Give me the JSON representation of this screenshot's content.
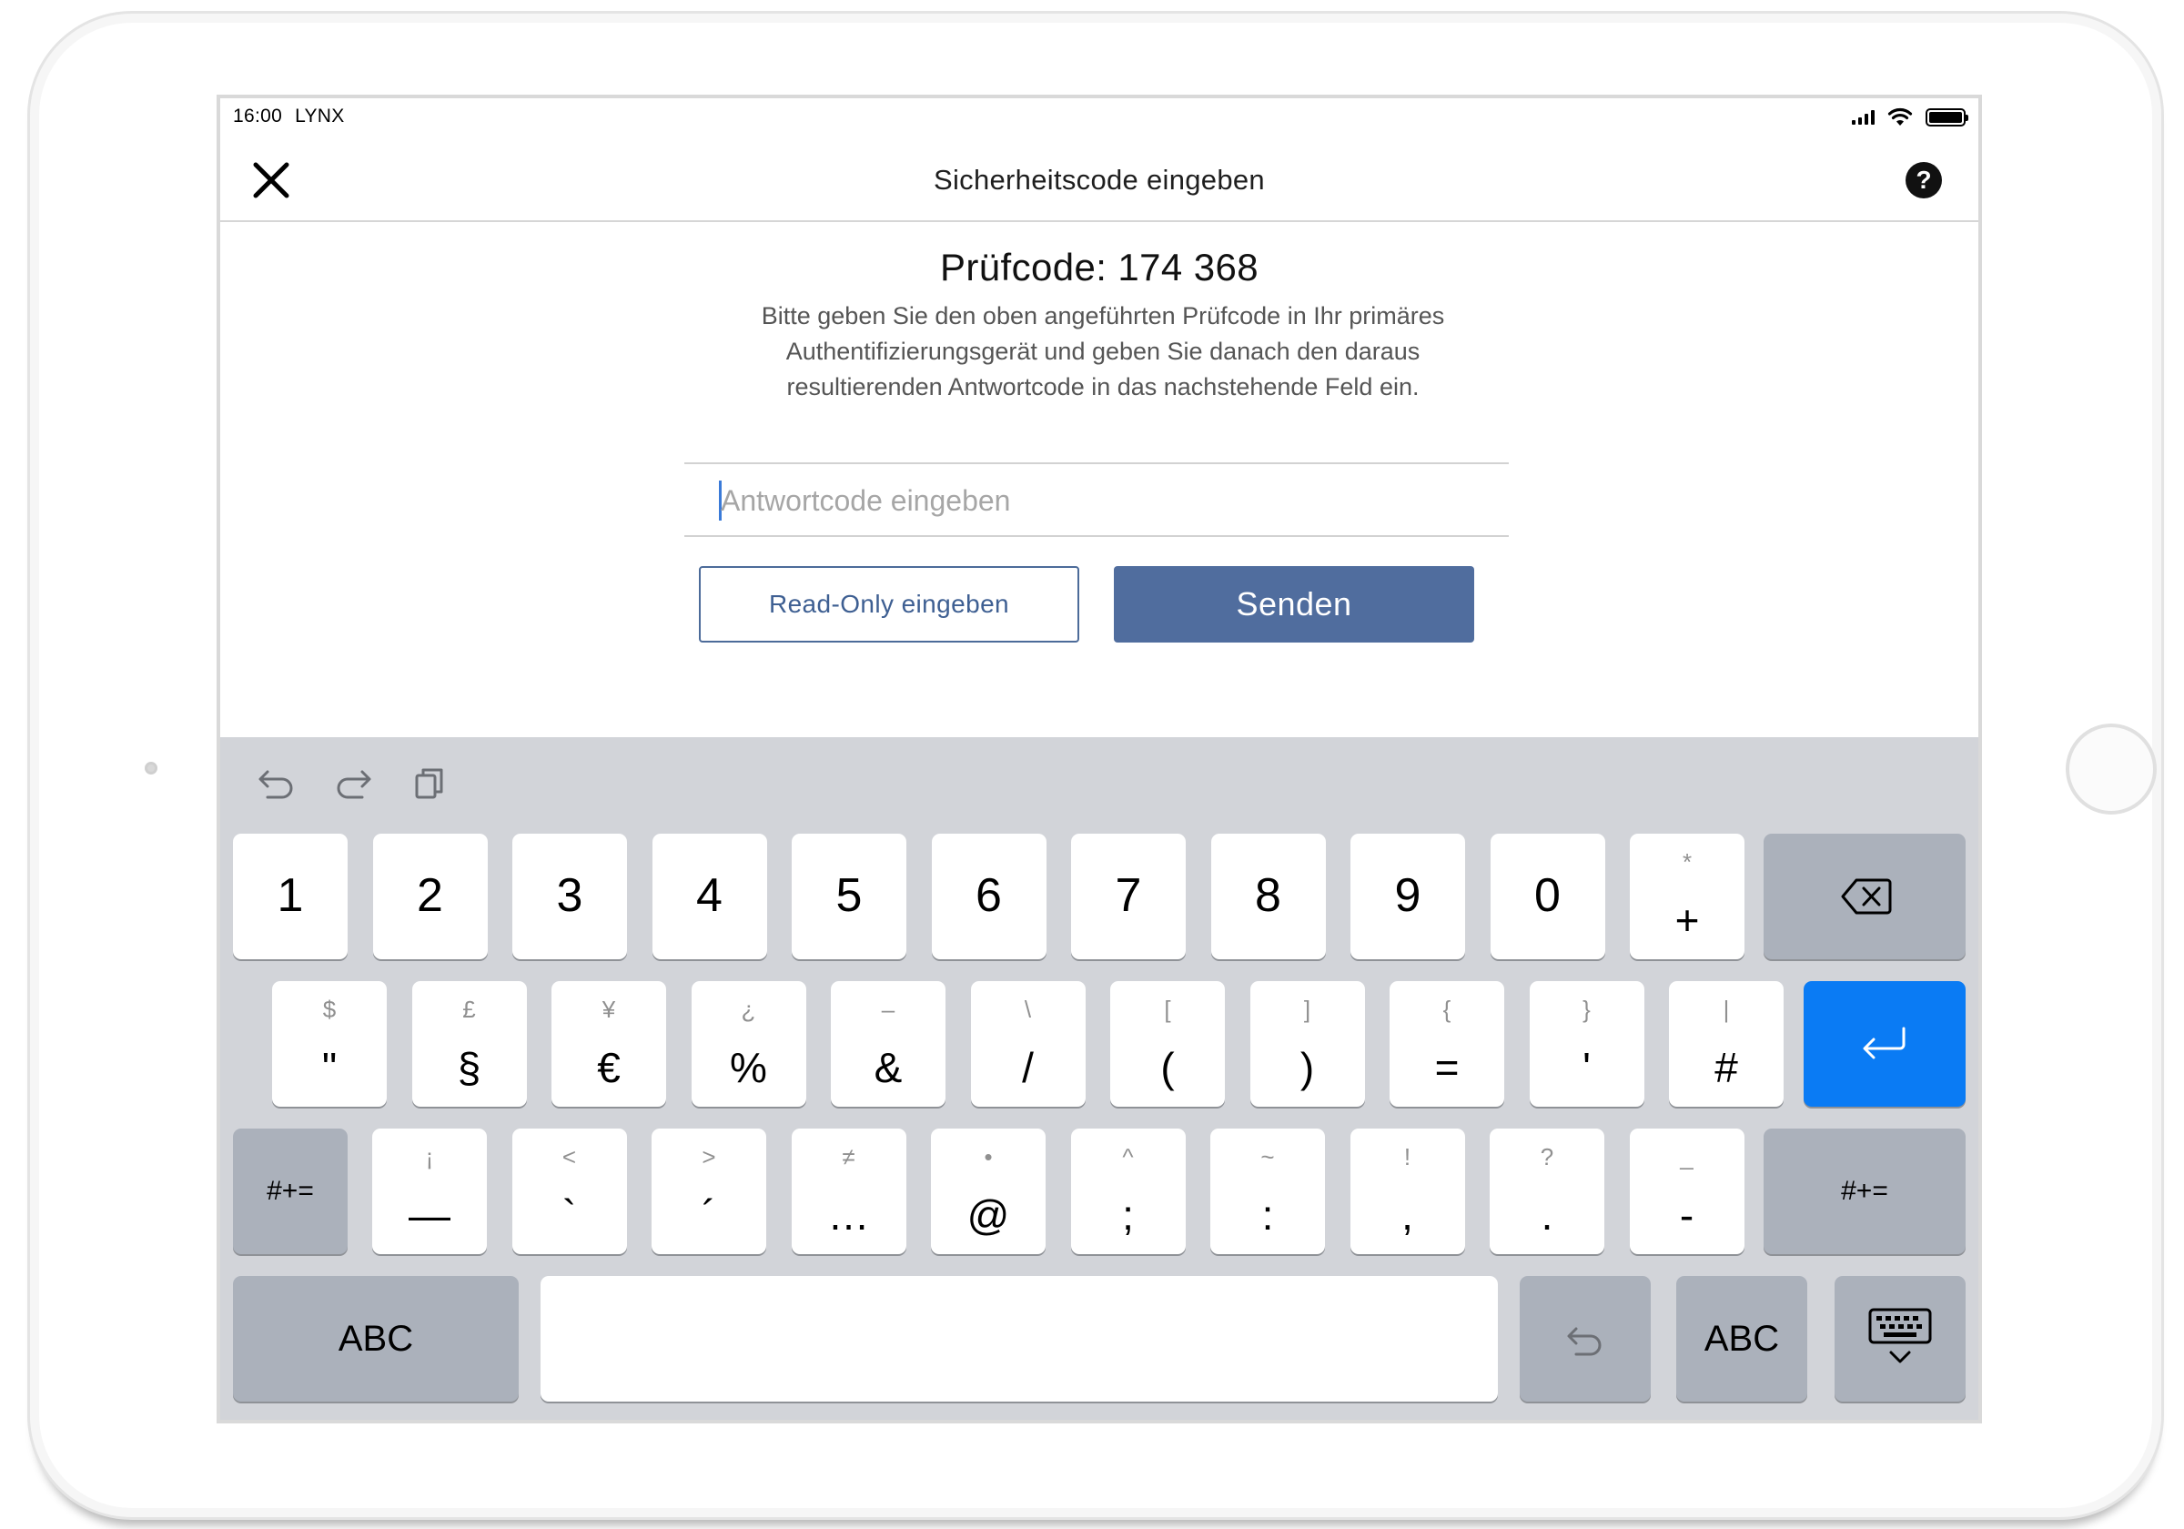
{
  "status_bar": {
    "time": "16:00",
    "carrier": "LYNX"
  },
  "nav": {
    "title": "Sicherheitscode eingeben",
    "help_label": "?"
  },
  "content": {
    "code_title": "Prüfcode: 174 368",
    "instructions": "Bitte geben Sie den oben angeführten Prüfcode in Ihr primäres\nAuthentifizierungsgerät und geben Sie danach den daraus\nresultierenden Antwortcode in das nachstehende Feld ein.",
    "answer_field": {
      "placeholder": "Antwortcode eingeben",
      "value": ""
    },
    "read_only_button": "Read-Only eingeben",
    "send_button": "Senden"
  },
  "keyboard": {
    "shortcut_icons": [
      "undo-icon",
      "redo-icon",
      "paste-icon"
    ],
    "row1": [
      {
        "main": "1"
      },
      {
        "main": "2"
      },
      {
        "main": "3"
      },
      {
        "main": "4"
      },
      {
        "main": "5"
      },
      {
        "main": "6"
      },
      {
        "main": "7"
      },
      {
        "main": "8"
      },
      {
        "main": "9"
      },
      {
        "main": "0"
      },
      {
        "alt": "*",
        "main": "+"
      }
    ],
    "row2": [
      {
        "alt": "$",
        "main": "\""
      },
      {
        "alt": "£",
        "main": "§"
      },
      {
        "alt": "¥",
        "main": "€"
      },
      {
        "alt": "¿",
        "main": "%"
      },
      {
        "alt": "–",
        "main": "&"
      },
      {
        "alt": "\\",
        "main": "/"
      },
      {
        "alt": "[",
        "main": "("
      },
      {
        "alt": "]",
        "main": ")"
      },
      {
        "alt": "{",
        "main": "="
      },
      {
        "alt": "}",
        "main": "'"
      },
      {
        "alt": "|",
        "main": "#"
      }
    ],
    "row3": [
      {
        "alt": "¡",
        "main": "—"
      },
      {
        "alt": "<",
        "main": "`"
      },
      {
        "alt": ">",
        "main": "´"
      },
      {
        "alt": "≠",
        "main": "…"
      },
      {
        "alt": "•",
        "main": "@"
      },
      {
        "alt": "^",
        "main": ";"
      },
      {
        "alt": "~",
        "main": ":"
      },
      {
        "alt": "!",
        "main": ","
      },
      {
        "alt": "?",
        "main": "."
      },
      {
        "alt": "_",
        "main": "-"
      }
    ],
    "symbols_key_label": "#+=",
    "abc_key_label": "ABC",
    "icons": {
      "delete": "backspace-icon",
      "return": "return-icon",
      "undo": "undo-icon",
      "dismiss": "keyboard-dismiss-icon"
    },
    "colors": {
      "background": "#d2d4d9",
      "return_key": "#0a7bf4",
      "function_key": "#abb1bb"
    }
  },
  "colors": {
    "primary": "#506d9e",
    "outline": "#4c6b99"
  }
}
